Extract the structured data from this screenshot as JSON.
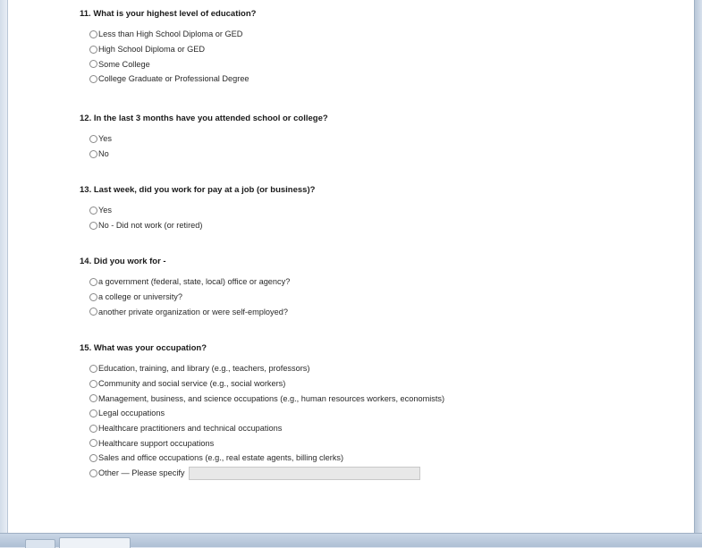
{
  "questions": [
    {
      "title": "11. What is your highest level of education?",
      "options": [
        "Less than High School Diploma or GED",
        "High School Diploma or GED",
        "Some College",
        "College Graduate or Professional Degree"
      ]
    },
    {
      "title": "12. In the last 3 months have you attended school or college?",
      "options": [
        "Yes",
        "No"
      ]
    },
    {
      "title": "13. Last week, did you work for pay at a job (or business)?",
      "options": [
        "Yes",
        "No - Did not work (or retired)"
      ]
    },
    {
      "title": "14. Did you work for -",
      "options": [
        "a government (federal, state, local) office or agency?",
        "a college or university?",
        "another private organization or were self-employed?"
      ]
    },
    {
      "title": "15. What was your occupation?",
      "options": [
        "Education, training, and library (e.g., teachers, professors)",
        "Community and social service (e.g., social workers)",
        "Management, business, and science occupations (e.g., human resources workers, economists)",
        "Legal occupations",
        "Healthcare practitioners and technical occupations",
        "Healthcare support occupations",
        "Sales and office occupations (e.g., real estate agents, billing clerks)"
      ],
      "other_label": "Other — Please specify",
      "other_value": ""
    }
  ]
}
